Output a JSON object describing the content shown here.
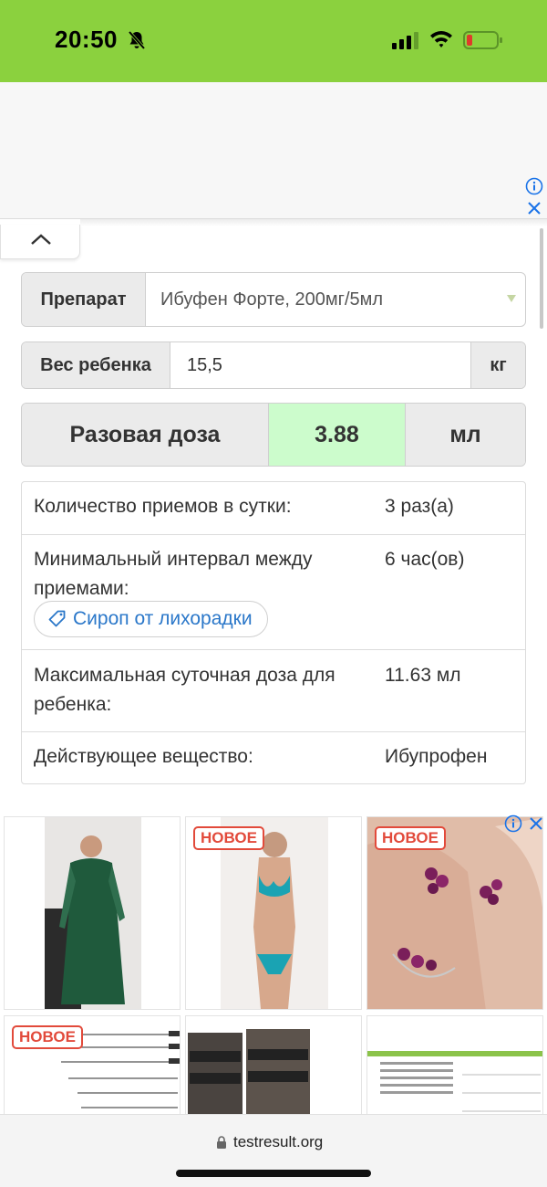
{
  "status_bar": {
    "time": "20:50",
    "bg_color": "#8bd13e",
    "icons": [
      "bell-muted-icon",
      "signal-icon",
      "wifi-icon",
      "battery-low-icon"
    ]
  },
  "form": {
    "drug_label": "Препарат",
    "drug_value": "Ибуфен Форте, 200мг/5мл",
    "weight_label": "Вес ребенка",
    "weight_value": "15,5",
    "weight_unit": "кг",
    "dose_label": "Разовая доза",
    "dose_value": "3.88",
    "dose_unit": "мл",
    "dose_value_bg": "#ccfccc"
  },
  "info": {
    "rows": [
      {
        "key": "Количество приемов в сутки:",
        "value": "3 раз(а)"
      },
      {
        "key": "Минимальный интервал между приемами:",
        "value": "6 час(ов)"
      },
      {
        "key": "Максимальная суточная доза для ребенка:",
        "value": "11.63 мл"
      },
      {
        "key": "Действующее вещество:",
        "value": "Ибупрофен"
      }
    ],
    "tag": "Сироп от лихорадки"
  },
  "ads": {
    "badge": "НОВОЕ"
  },
  "browser": {
    "url": "testresult.org"
  },
  "colors": {
    "link": "#2a77c9",
    "badge": "#e24a3b"
  }
}
